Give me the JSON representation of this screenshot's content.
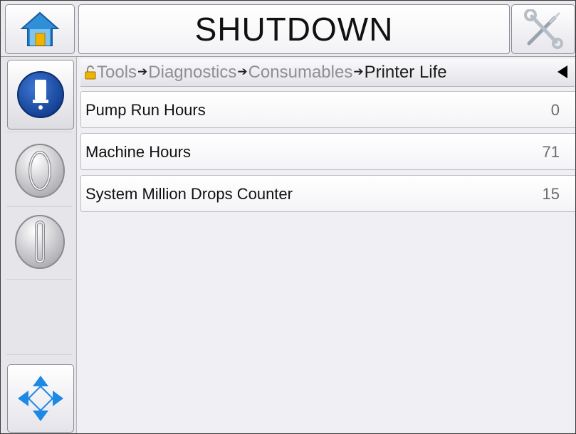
{
  "header": {
    "title": "SHUTDOWN"
  },
  "breadcrumb": {
    "items": [
      "Tools",
      "Diagnostics",
      "Consumables"
    ],
    "current": "Printer Life",
    "separator": "➔"
  },
  "parameters": [
    {
      "label": "Pump Run Hours",
      "value": "0"
    },
    {
      "label": "Machine Hours",
      "value": "71"
    },
    {
      "label": "System Million Drops Counter",
      "value": "15"
    }
  ],
  "colors": {
    "accent_blue": "#1c4fa8",
    "home_roof": "#2f8fd8",
    "home_door": "#f0b400",
    "nav_arrow": "#1e88e5"
  },
  "icons": {
    "home": "home-icon",
    "tools": "tools-icon",
    "ink": "ink-cartridge-icon",
    "start": "jet-start-icon",
    "stop": "jet-stop-icon",
    "navigate": "navigation-arrows-icon",
    "lock": "lock-icon",
    "back": "back-arrow-icon"
  }
}
